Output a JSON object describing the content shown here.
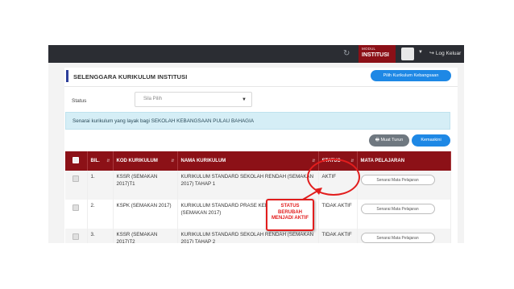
{
  "topbar": {
    "refresh_icon": "refresh-icon",
    "modul_line1": "MODUL",
    "modul_line2": "INSTITUSI",
    "logout_label": "Log Keluar"
  },
  "header": {
    "title": "SELENGGARA KURIKULUM INSTITUSI",
    "pilih_button": "Pilih Kurikulum Kebangsaan"
  },
  "filter": {
    "status_label": "Status",
    "status_value": "Sila Pilih"
  },
  "info_message": "Senarai kurikulum yang layak bagi SEKOLAH KEBANGSAAN PULAU BAHAGIA",
  "actions": {
    "muat_turun": "Muat Turun",
    "kemaskini": "Kemaskini"
  },
  "table": {
    "columns": [
      "BIL.",
      "KOD KURIKULUM",
      "NAMA KURIKULUM",
      "STATUS",
      "MATA PELAJARAN"
    ],
    "rows": [
      {
        "bil": "1.",
        "kod": "KSSR (SEMAKAN 2017)T1",
        "nama": "KURIKULUM STANDARD SEKOLAH RENDAH (SEMAKAN 2017) TAHAP 1",
        "status": "AKTIF",
        "button": "Senarai Mata Pelajaran"
      },
      {
        "bil": "2.",
        "kod": "KSPK (SEMAKAN 2017)",
        "nama": "KURIKULUM STANDARD PRASE KEBANGSAAN (SEMAKAN 2017)",
        "status": "TIDAK AKTIF",
        "button": "Senarai Mata Pelajaran"
      },
      {
        "bil": "3.",
        "kod": "KSSR (SEMAKAN 2017)T2",
        "nama": "KURIKULUM STANDARD SEKOLAH RENDAH (SEMAKAN 2017) TAHAP 2",
        "status": "TIDAK AKTIF",
        "button": "Senarai Mata Pelajaran"
      }
    ]
  },
  "annotation": {
    "line1": "STATUS",
    "line2": "BERUBAH",
    "line3": "MENJADI AKTIF",
    "color": "#e21d1d"
  }
}
